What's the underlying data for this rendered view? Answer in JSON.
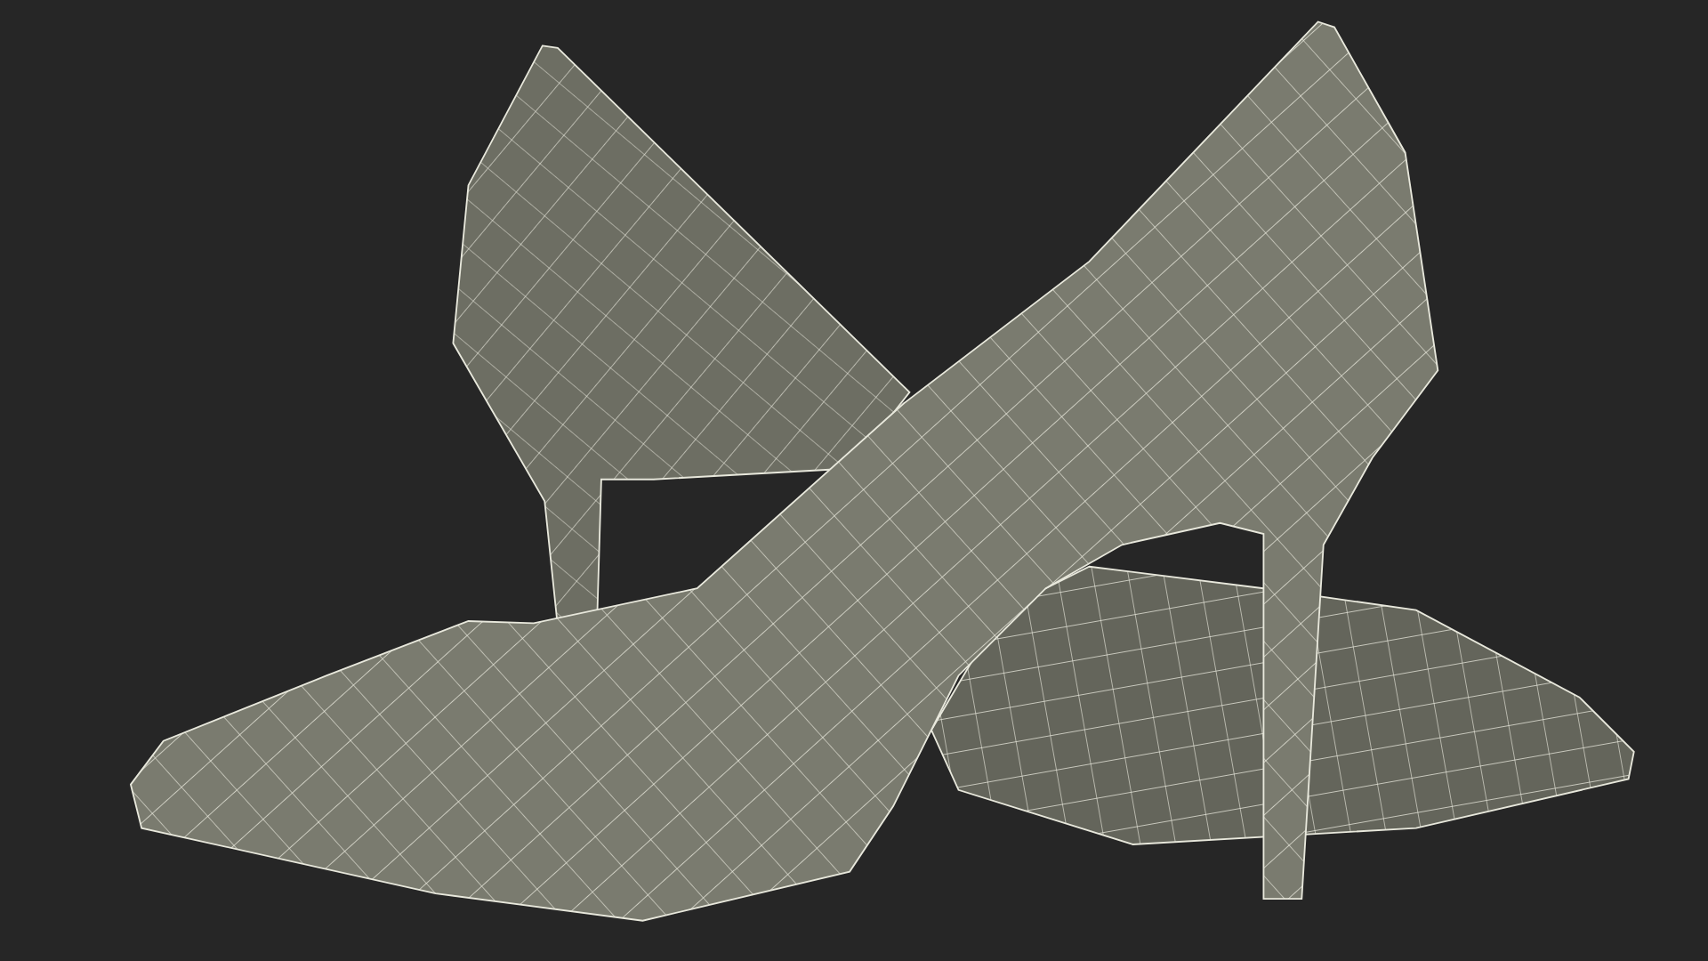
{
  "scene": {
    "kind": "wireframe"
  }
}
